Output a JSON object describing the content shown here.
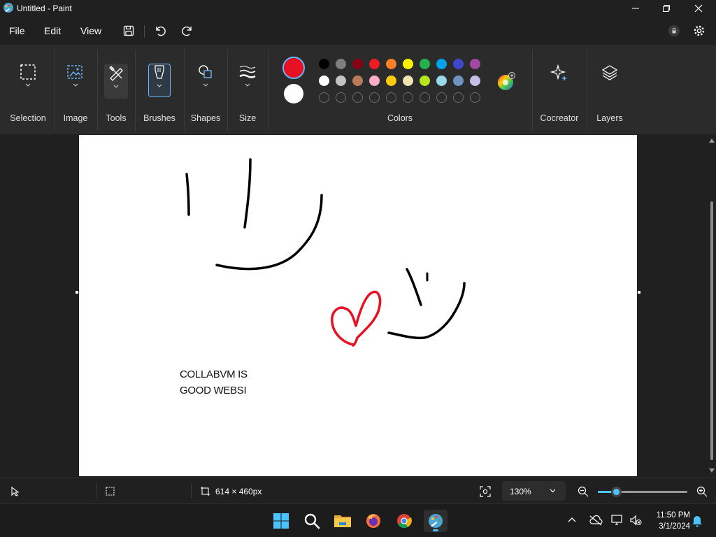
{
  "window": {
    "title": "Untitled - Paint"
  },
  "menu": {
    "file": "File",
    "edit": "Edit",
    "view": "View"
  },
  "ribbon": {
    "groups": {
      "selection": "Selection",
      "image": "Image",
      "tools": "Tools",
      "brushes": "Brushes",
      "shapes": "Shapes",
      "size": "Size",
      "colors": "Colors",
      "cocreator": "Cocreator",
      "layers": "Layers"
    },
    "primary_color": "#e81123",
    "secondary_color": "#ffffff",
    "palette_row1": [
      "#000000",
      "#7f7f7f",
      "#880015",
      "#ed1c24",
      "#ff7f27",
      "#fff200",
      "#22b14c",
      "#00a2e8",
      "#3f48cc",
      "#a349a4"
    ],
    "palette_row2": [
      "#ffffff",
      "#c3c3c3",
      "#b97a57",
      "#ffaec9",
      "#ffc90e",
      "#efe4b0",
      "#b5e61d",
      "#99d9ea",
      "#7092be",
      "#c8bfe7"
    ],
    "palette_row3_custom_slots": 10
  },
  "canvas": {
    "text_line1": "COLLABVM IS",
    "text_line2": "GOOD WEBSI",
    "stroke_color": "#000000",
    "heart_color": "#e81123"
  },
  "status": {
    "canvas_size": "614 × 460px",
    "zoom": "130%",
    "zoom_slider_fraction": 0.2
  },
  "taskbar": {
    "time": "11:50 PM",
    "date": "3/1/2024",
    "apps": [
      "start-icon",
      "search-icon",
      "file-explorer-icon",
      "firefox-icon",
      "chrome-icon",
      "paint-icon"
    ]
  }
}
